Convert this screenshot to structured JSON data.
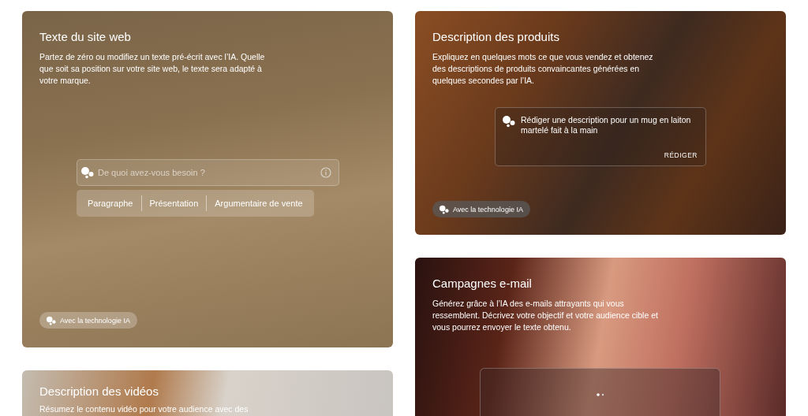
{
  "columns": [
    [
      {
        "title": "Texte du site web",
        "description": "Partez de zéro ou modifiez un texte pré-écrit avec l’IA. Quelle que soit sa position sur votre site web, le texte sera adapté à votre marque.",
        "widget": {
          "kind": "input",
          "placeholder": "De quoi avez-vous besoin ?",
          "chips": [
            "Paragraphe",
            "Présentation",
            "Argumentaire de vente"
          ]
        },
        "badge": "Avec la technologie IA"
      },
      {
        "title": "Description des vidéos",
        "description": "Résumez le contenu vidéo pour votre audience avec des"
      }
    ],
    [
      {
        "title": "Description des produits",
        "description": "Expliquez en quelques mots ce que vous vendez et obtenez des descriptions de produits convaincantes générées en quelques secondes par l’IA.",
        "widget": {
          "kind": "prompt",
          "text": "Rédiger une description pour un mug en laiton martelé fait à la main",
          "action": "RÉDIGER"
        },
        "badge": "Avec la technologie IA"
      },
      {
        "title": "Campagnes e-mail",
        "description": "Générez grâce à l’IA des e-mails attrayants qui vous ressemblent. Décrivez votre objectif et votre audience cible et vous pourrez envoyer le texte obtenu.",
        "widget": {
          "kind": "loading"
        }
      }
    ]
  ]
}
